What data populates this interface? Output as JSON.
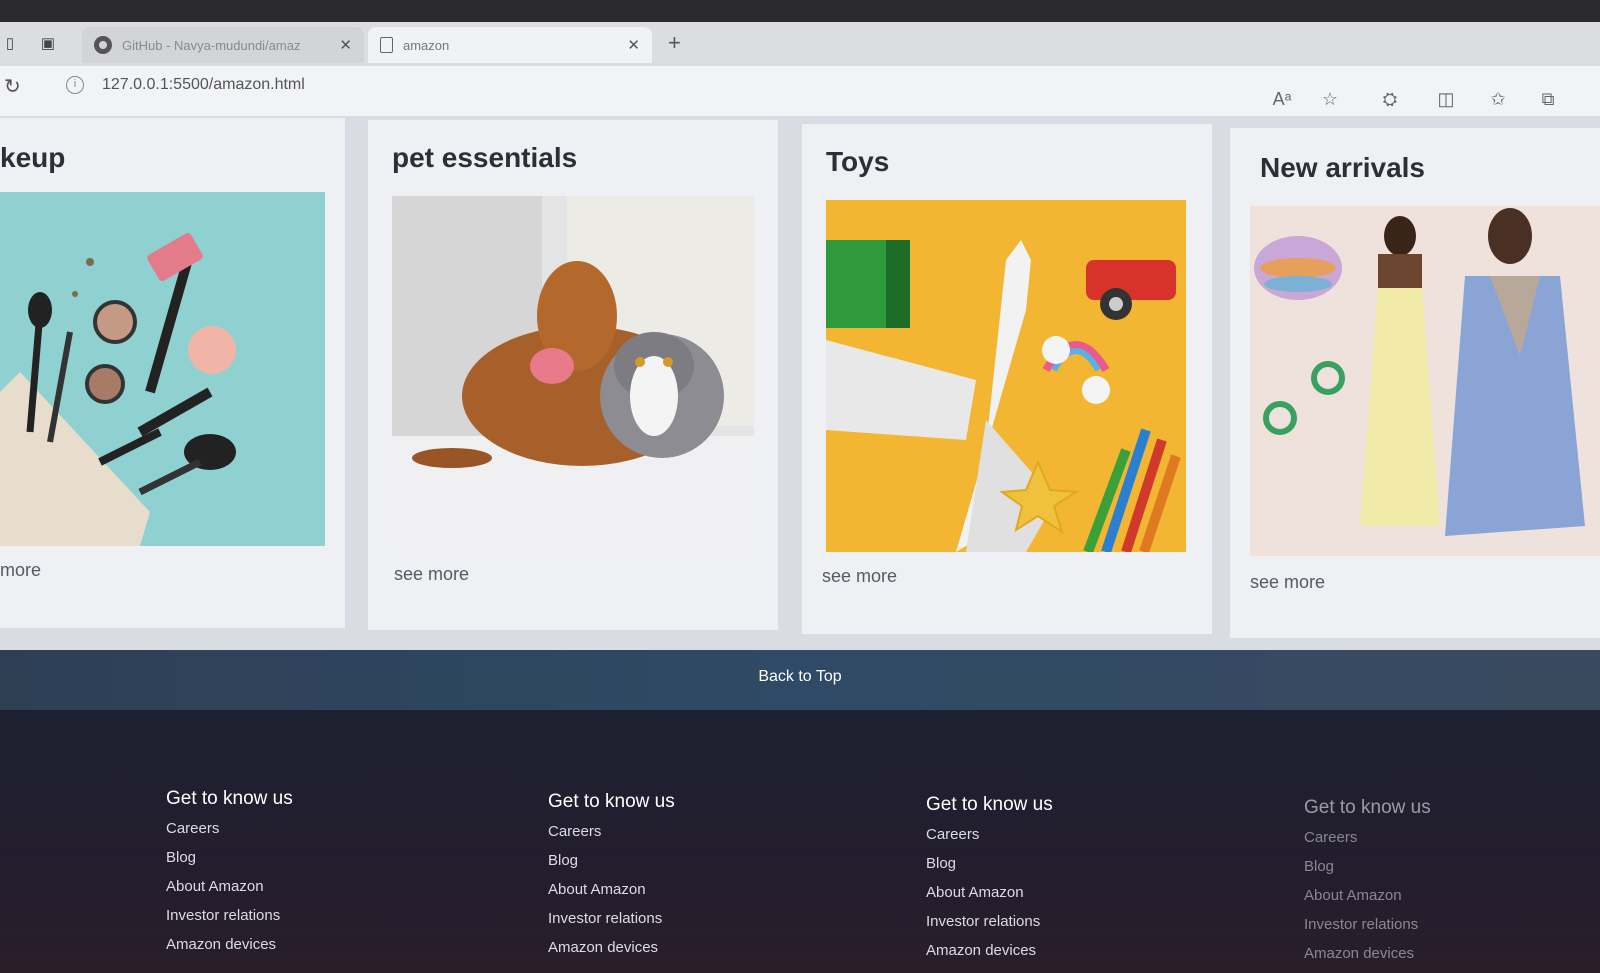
{
  "browser": {
    "tabs": [
      {
        "title": "GitHub - Navya-mudundi/amaz",
        "icon": "github-icon"
      },
      {
        "title": "amazon",
        "icon": "document-icon"
      }
    ],
    "url": "127.0.0.1:5500/amazon.html",
    "toolbar_icons": [
      "read-aloud-icon",
      "favorite-icon",
      "extensions-icon",
      "split-screen-icon",
      "favorites-list-icon",
      "collections-icon"
    ]
  },
  "cards": [
    {
      "title": "keup",
      "link": "more"
    },
    {
      "title": "pet essentials",
      "link": "see more"
    },
    {
      "title": "Toys",
      "link": "see more"
    },
    {
      "title": "New arrivals",
      "link": "see more"
    }
  ],
  "back_to_top": "Back to Top",
  "footer": {
    "columns": [
      {
        "heading": "Get to know us",
        "links": [
          "Careers",
          "Blog",
          "About Amazon",
          "Investor relations",
          "Amazon devices"
        ]
      },
      {
        "heading": "Get to know us",
        "links": [
          "Careers",
          "Blog",
          "About Amazon",
          "Investor relations",
          "Amazon devices"
        ]
      },
      {
        "heading": "Get to know us",
        "links": [
          "Careers",
          "Blog",
          "About Amazon",
          "Investor relations",
          "Amazon devices"
        ]
      },
      {
        "heading": "Get to know us",
        "links": [
          "Careers",
          "Blog",
          "About Amazon",
          "Investor relations",
          "Amazon devices"
        ]
      }
    ]
  }
}
